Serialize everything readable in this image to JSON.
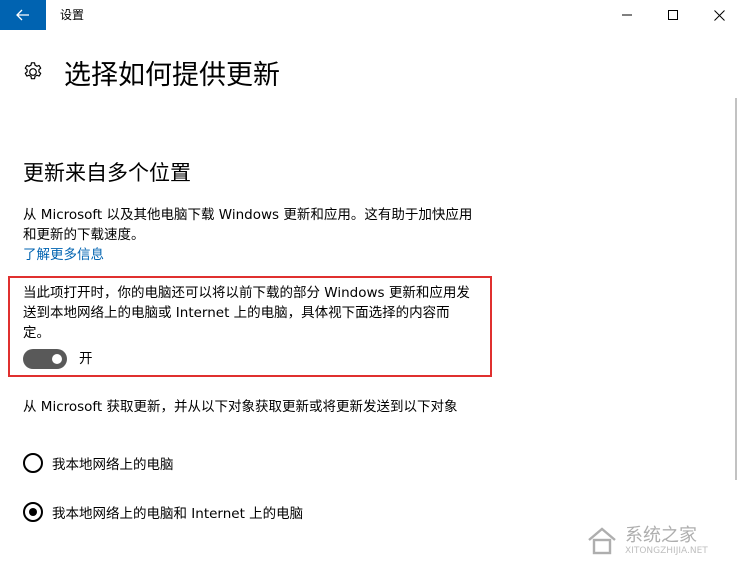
{
  "window": {
    "title": "设置",
    "back_icon": "arrow-left-icon",
    "accent": "#0063b1"
  },
  "page": {
    "title": "选择如何提供更新",
    "icon": "gear-icon"
  },
  "section": {
    "title": "更新来自多个位置",
    "description": "从 Microsoft 以及其他电脑下载 Windows 更新和应用。这有助于加快应用和更新的下载速度。",
    "learn_more": "了解更多信息"
  },
  "toggle": {
    "description": "当此项打开时，你的电脑还可以将以前下载的部分 Windows 更新和应用发送到本地网络上的电脑或 Internet 上的电脑，具体视下面选择的内容而定。",
    "state_label": "开",
    "is_on": true,
    "highlight_color": "#e0302f"
  },
  "source": {
    "description": "从 Microsoft 获取更新，并从以下对象获取更新或将更新发送到以下对象",
    "options": [
      {
        "label": "我本地网络上的电脑",
        "checked": false
      },
      {
        "label": "我本地网络上的电脑和 Internet 上的电脑",
        "checked": true
      }
    ]
  },
  "watermark": {
    "text_cn": "系统之家",
    "text_en": "XITONGZHIJIA.NET"
  }
}
